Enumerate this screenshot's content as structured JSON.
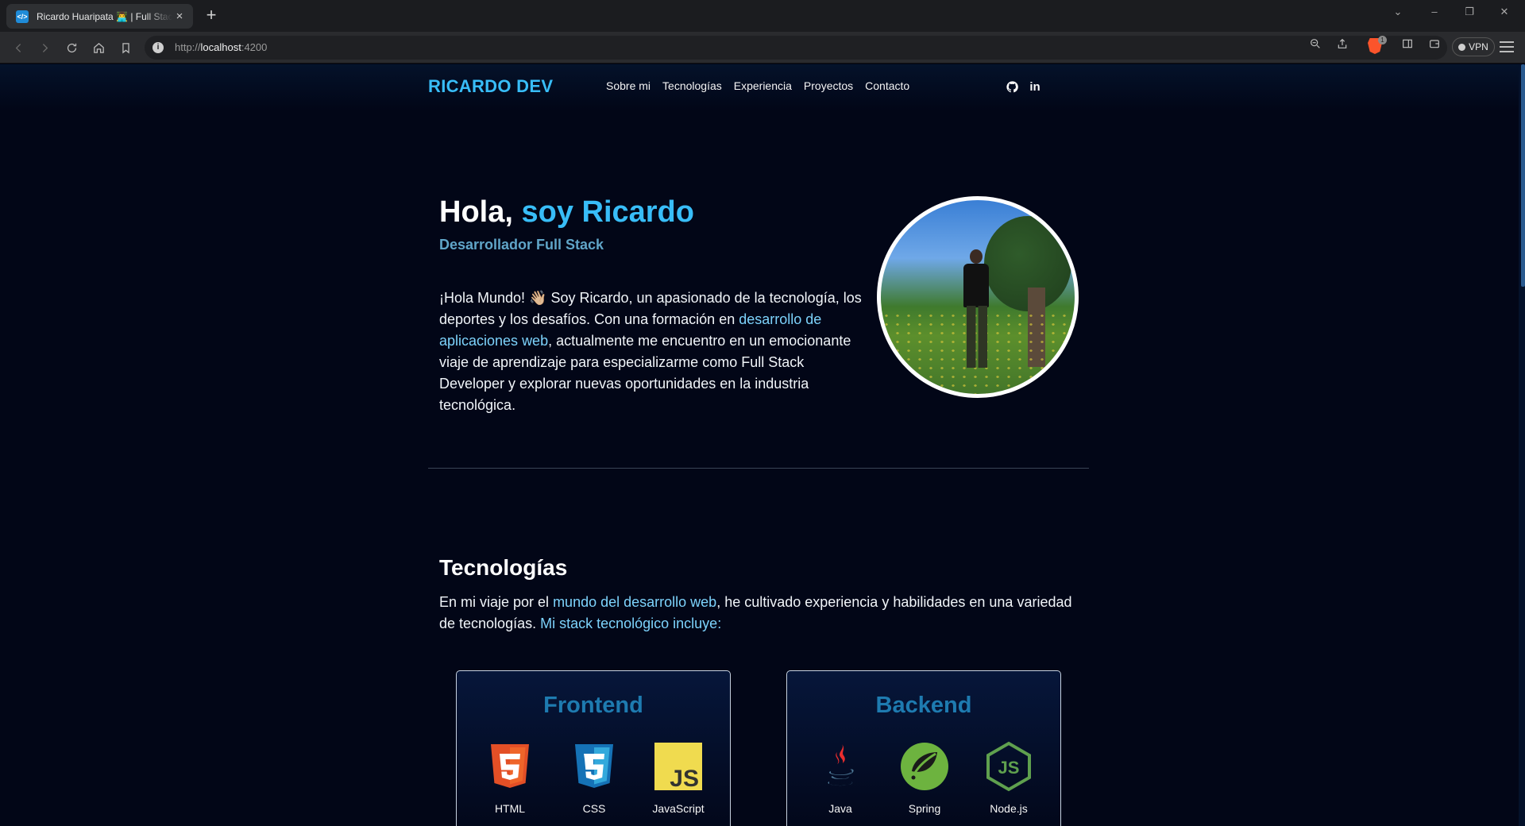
{
  "browser": {
    "tab_title": "Ricardo Huaripata 👨‍💻 | Full Stack",
    "tab_close": "×",
    "new_tab": "+",
    "url_prefix": "http://",
    "url_host": "localhost",
    "url_port": ":4200",
    "brave_badge": "1",
    "vpn_label": "VPN"
  },
  "nav": {
    "brand": "RICARDO DEV",
    "links": [
      "Sobre mi",
      "Tecnologías",
      "Experiencia",
      "Proyectos",
      "Contacto"
    ],
    "social_icons": [
      "github-icon",
      "linkedin-icon"
    ],
    "linkedin_text": "in"
  },
  "hero": {
    "greeting": "Hola,",
    "name": "soy Ricardo",
    "subtitle": "Desarrollador Full Stack",
    "text_1": "¡Hola Mundo! 👋🏼 Soy Ricardo, un apasionado de la tecnología, los deportes y los desafíos. Con una formación en ",
    "text_hl": "desarrollo de aplicaciones web",
    "text_2": ", actualmente me encuentro en un emocionante viaje de aprendizaje para especializarme como Full Stack Developer y explorar nuevas oportunidades en la industria tecnológica."
  },
  "tech": {
    "title": "Tecnologías",
    "text_1": "En mi viaje por el ",
    "text_hl1": "mundo del desarrollo web",
    "text_2": ", he cultivado experiencia y habilidades en una variedad de tecnologías. ",
    "text_hl2": "Mi stack tecnológico incluye:",
    "cards": [
      {
        "title": "Frontend",
        "items": [
          "HTML",
          "CSS",
          "JavaScript"
        ]
      },
      {
        "title": "Backend",
        "items": [
          "Java",
          "Spring",
          "Node.js"
        ]
      }
    ]
  },
  "colors": {
    "accent": "#38bdf8",
    "background": "#020617",
    "card_title": "#1e7bb0",
    "highlight": "#7dd3fc"
  }
}
